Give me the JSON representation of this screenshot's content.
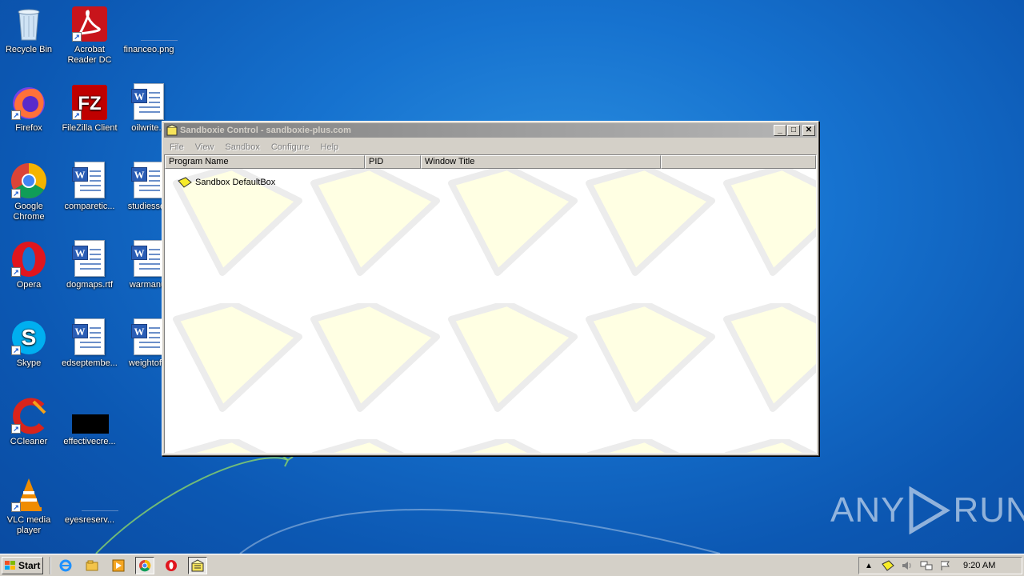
{
  "desktop": {
    "icons": [
      {
        "label": "Recycle Bin"
      },
      {
        "label": "Acrobat Reader DC"
      },
      {
        "label": "financeo.png"
      },
      {
        "label": "Firefox"
      },
      {
        "label": "FileZilla Client"
      },
      {
        "label": "oilwrite..."
      },
      {
        "label": "Google Chrome"
      },
      {
        "label": "comparetic..."
      },
      {
        "label": "studiessep"
      },
      {
        "label": "Opera"
      },
      {
        "label": "dogmaps.rtf"
      },
      {
        "label": "warmanuf"
      },
      {
        "label": "Skype"
      },
      {
        "label": "edseptembe..."
      },
      {
        "label": "weightofta"
      },
      {
        "label": "CCleaner"
      },
      {
        "label": "effectivecre..."
      },
      {
        "label": "VLC media player"
      },
      {
        "label": "eyesreserv..."
      }
    ]
  },
  "window": {
    "title": "Sandboxie Control - sandboxie-plus.com",
    "menu": [
      "File",
      "View",
      "Sandbox",
      "Configure",
      "Help"
    ],
    "columns": [
      "Program Name",
      "PID",
      "Window Title",
      ""
    ],
    "rows": [
      {
        "name": "Sandbox DefaultBox",
        "pid": "",
        "window_title": ""
      }
    ],
    "colors": {
      "title_gradient_start": "#808080",
      "title_gradient_end": "#b5b5b5",
      "chrome": "#d4d0c8"
    }
  },
  "taskbar": {
    "start_label": "Start",
    "clock": "9:20 AM",
    "quick_launch": [
      "internet-explorer-icon",
      "explorer-icon",
      "media-player-icon",
      "chrome-icon",
      "opera-icon",
      "sandboxie-icon"
    ]
  },
  "watermark": {
    "left": "ANY",
    "right": "RUN"
  }
}
